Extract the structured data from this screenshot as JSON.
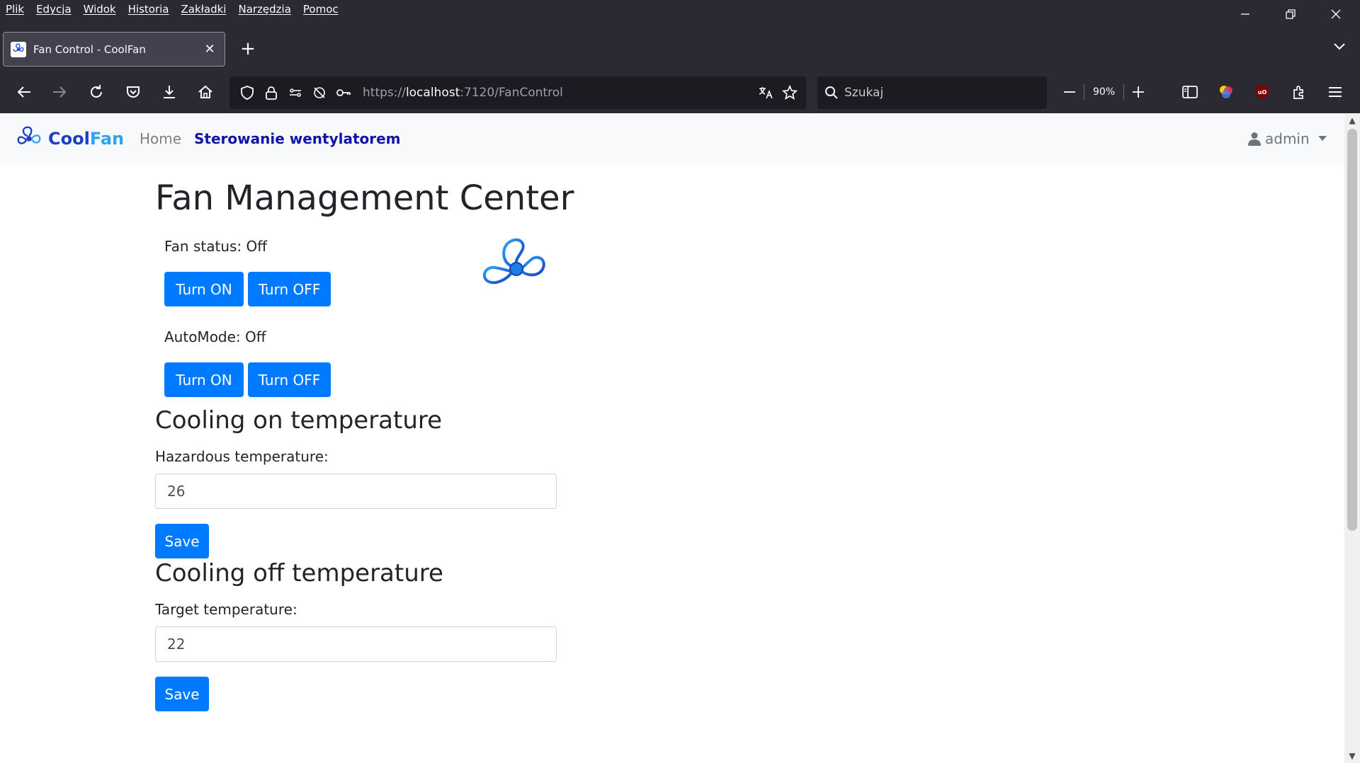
{
  "menubar": {
    "items": [
      "Plik",
      "Edycja",
      "Widok",
      "Historia",
      "Zakładki",
      "Narzędzia",
      "Pomoc"
    ]
  },
  "window_controls": {
    "minimize": "—",
    "restore": "❐",
    "close": "✕"
  },
  "tab": {
    "title": "Fan Control - CoolFan"
  },
  "address_bar": {
    "scheme": "https://",
    "host": "localhost",
    "rest": ":7120/FanControl"
  },
  "search_bar": {
    "placeholder": "Szukaj"
  },
  "zoom": {
    "level": "90%"
  },
  "site": {
    "brand_cool": "Cool",
    "brand_fan": "Fan",
    "nav_home": "Home",
    "nav_fan_control": "Sterowanie wentylatorem",
    "user": "admin",
    "colors": {
      "primary_button": "#007bff",
      "brand_dark": "#1a40c4",
      "brand_light": "#2fa3f0",
      "active_nav": "#1016a8"
    }
  },
  "main": {
    "title": "Fan Management Center",
    "fan_status": "Fan status: Off",
    "fan_on_label": "Turn ON",
    "fan_off_label": "Turn OFF",
    "auto_mode": "AutoMode: Off",
    "auto_on_label": "Turn ON",
    "auto_off_label": "Turn OFF",
    "cooling_on": {
      "heading": "Cooling on temperature",
      "label": "Hazardous temperature:",
      "value": "26",
      "save_label": "Save"
    },
    "cooling_off": {
      "heading": "Cooling off temperature",
      "label": "Target temperature:",
      "value": "22",
      "save_label": "Save"
    }
  }
}
